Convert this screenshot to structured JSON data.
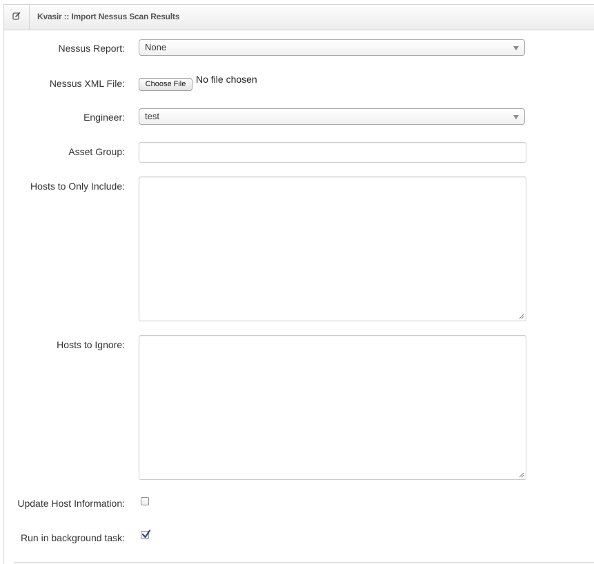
{
  "header": {
    "title": "Kvasir :: Import Nessus Scan Results",
    "icon": "edit-icon"
  },
  "form": {
    "nessus_report": {
      "label": "Nessus Report:",
      "value": "None"
    },
    "nessus_xml_file": {
      "label": "Nessus XML File:",
      "button_label": "Choose File",
      "status": "No file chosen"
    },
    "engineer": {
      "label": "Engineer:",
      "value": "test"
    },
    "asset_group": {
      "label": "Asset Group:",
      "value": ""
    },
    "hosts_include": {
      "label": "Hosts to Only Include:",
      "value": ""
    },
    "hosts_ignore": {
      "label": "Hosts to Ignore:",
      "value": ""
    },
    "update_host_info": {
      "label": "Update Host Information:",
      "checked": false
    },
    "run_background": {
      "label": "Run in background task:",
      "checked": true
    }
  },
  "colors": {
    "check_mark": "#2d4f86",
    "panel_border": "#d4d4d4"
  }
}
